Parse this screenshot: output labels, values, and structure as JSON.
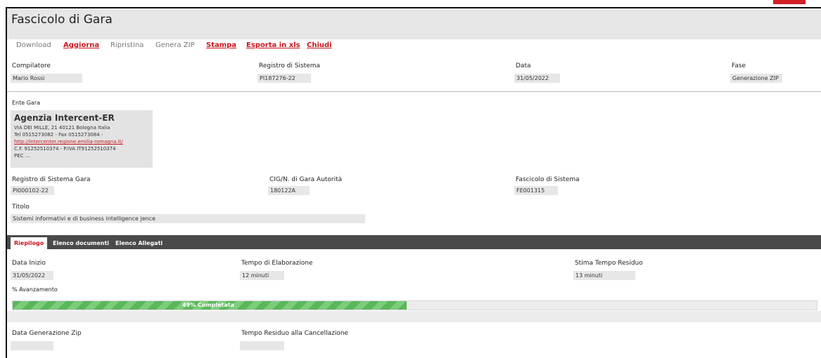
{
  "page_title": "Fascicolo di Gara",
  "toolbar": {
    "download": "Download",
    "aggiorna": "Aggiorna",
    "ripristina": "Ripristina",
    "genera_zip": "Genera ZIP",
    "stampa": "Stampa",
    "esporta": "Esporta in xls",
    "chiudi": "Chiudi"
  },
  "fields": {
    "compilatore": {
      "label": "Compilatore",
      "value": "Mario Rossi"
    },
    "registro_sistema": {
      "label": "Registro di Sistema",
      "value": "PI187276-22"
    },
    "data": {
      "label": "Data",
      "value": "31/05/2022"
    },
    "fase": {
      "label": "Fase",
      "value": "Generazione ZIP"
    }
  },
  "ente": {
    "label": "Ente Gara",
    "name": "Agenzia Intercent-ER",
    "address": "VIA DEI MILLE, 21 40121 Bologna Italia",
    "tel": "Tel 0515273082 - Fax 0515273084 -",
    "url": "http://intercenter.regione.emilia-romagna.it/",
    "fiscal": "C.F. 91252510374 - P.IVA IT91252510374",
    "pec": "PEC ..."
  },
  "gara": {
    "registro_gara": {
      "label": "Registro di Sistema Gara",
      "value": "PI000102-22"
    },
    "cig": {
      "label": "CIG/N. di Gara Autorità",
      "value": "180122A"
    },
    "fascicolo": {
      "label": "Fascicolo di Sistema",
      "value": "FE001315"
    },
    "titolo": {
      "label": "Titolo",
      "value": "Sistemi informativi e di business intelligence   jence"
    }
  },
  "tabs": {
    "riepilogo": "Riepilogo",
    "documenti": "Elenco documenti",
    "allegati": "Elenco Allegati"
  },
  "riepilogo": {
    "data_inizio": {
      "label": "Data Inizio",
      "value": "31/05/2022"
    },
    "tempo_elaborazione": {
      "label": "Tempo di Elaborazione",
      "value": "12 minuti"
    },
    "stima_residuo": {
      "label": "Stima Tempo Residuo",
      "value": "13 minuti"
    },
    "avanzamento_label": "% Avanzamento",
    "progress_fraction": 0.49,
    "progress_text": "49% Completata",
    "data_generazione": {
      "label": "Data Generazione Zip",
      "value": ""
    },
    "tempo_cancellazione": {
      "label": "Tempo Residuo alla Cancellazione",
      "value": ""
    }
  },
  "colors": {
    "accent": "#c8171f",
    "progress": "#5ab75a",
    "tabbar": "#4a4a4a"
  }
}
